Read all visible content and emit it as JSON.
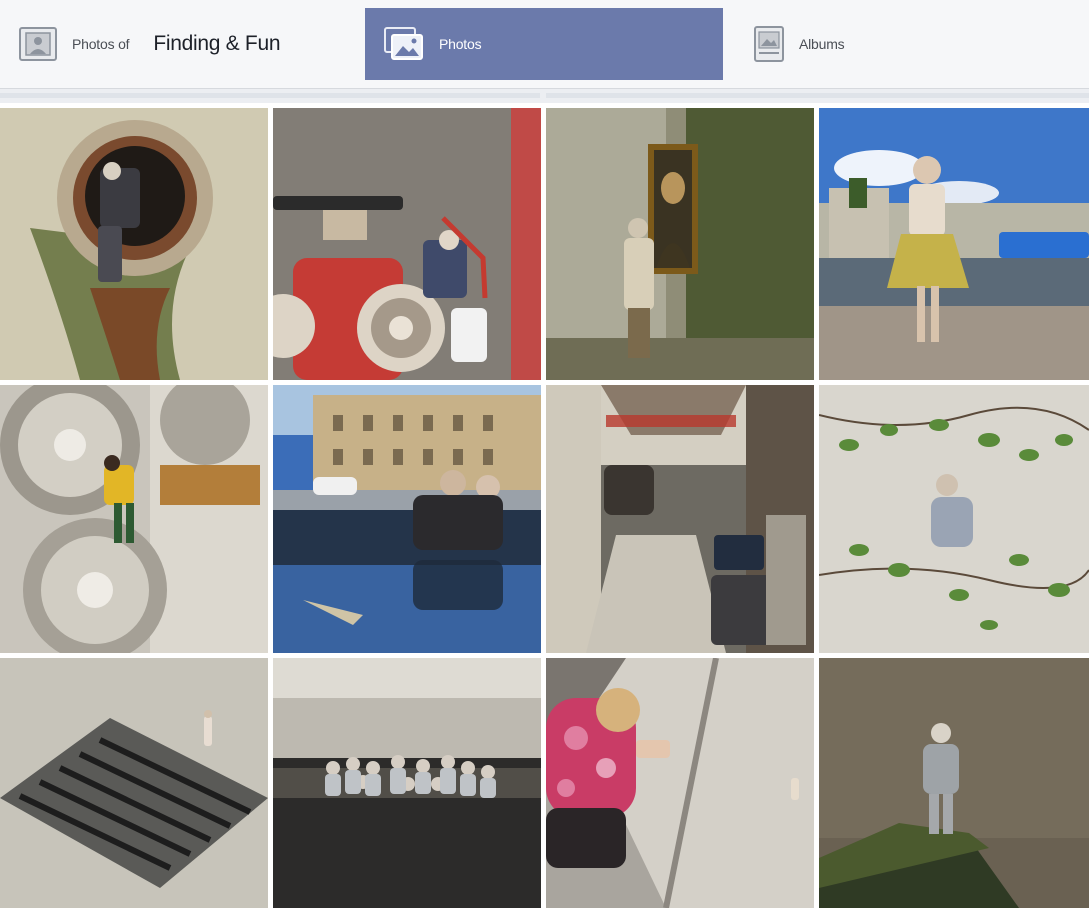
{
  "header": {
    "photos_of_label": "Photos of",
    "page_name": "Finding & Fun",
    "photos_label": "Photos",
    "albums_label": "Albums",
    "active_tab": "photos"
  },
  "colors": {
    "active_tab": "#6b7aab",
    "header_bg": "#f6f7f9"
  },
  "icons": {
    "photos_of": "photos-of-icon",
    "photos": "photos-icon",
    "albums": "album-icon"
  },
  "photos": [
    {
      "subject": "sewer-pipe-figure"
    },
    {
      "subject": "hydrant-figure"
    },
    {
      "subject": "mona-lisa-figure"
    },
    {
      "subject": "harbor-figure"
    },
    {
      "subject": "ac-unit-figure"
    },
    {
      "subject": "puddle-couple-figure"
    },
    {
      "subject": "alley-street"
    },
    {
      "subject": "ivy-wall-figure"
    },
    {
      "subject": "drain-grate-figure"
    },
    {
      "subject": "flooded-crowd"
    },
    {
      "subject": "photographer-woman"
    },
    {
      "subject": "rock-figure"
    }
  ]
}
